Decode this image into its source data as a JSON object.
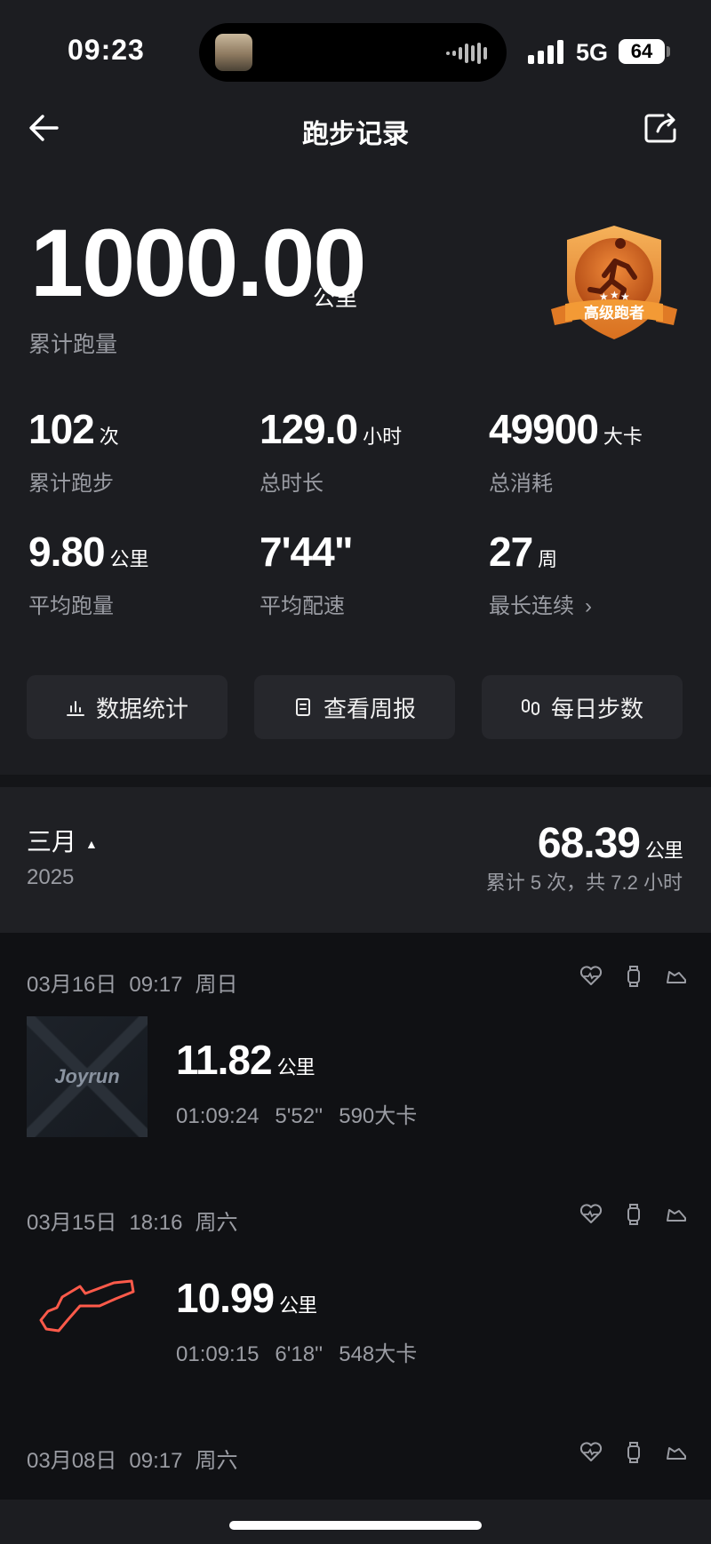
{
  "status": {
    "time": "09:23",
    "network": "5G",
    "battery": "64"
  },
  "nav": {
    "title": "跑步记录"
  },
  "summary": {
    "total_value": "1000.00",
    "total_unit": "公里",
    "total_label": "累计跑量",
    "badge_text": "高级跑者"
  },
  "stats": [
    {
      "value": "102",
      "unit": "次",
      "label": "累计跑步"
    },
    {
      "value": "129.0",
      "unit": "小时",
      "label": "总时长"
    },
    {
      "value": "49900",
      "unit": "大卡",
      "label": "总消耗"
    },
    {
      "value": "9.80",
      "unit": "公里",
      "label": "平均跑量"
    },
    {
      "value": "7'44\"",
      "unit": "",
      "label": "平均配速"
    },
    {
      "value": "27",
      "unit": "周",
      "label": "最长连续"
    }
  ],
  "actions": [
    {
      "label": "数据统计",
      "icon": "bar-chart-icon"
    },
    {
      "label": "查看周报",
      "icon": "report-icon"
    },
    {
      "label": "每日步数",
      "icon": "footprint-icon"
    }
  ],
  "month": {
    "name": "三月",
    "year": "2025",
    "km": "68.39",
    "km_unit": "公里",
    "summary": "累计 5 次，共 7.2 小时"
  },
  "records": [
    {
      "date": "03月16日",
      "time": "09:17",
      "weekday": "周日",
      "thumb_text": "Joyrun",
      "km": "11.82",
      "km_unit": "公里",
      "duration": "01:09:24",
      "pace": "5'52''",
      "kcal": "590大卡"
    },
    {
      "date": "03月15日",
      "time": "18:16",
      "weekday": "周六",
      "km": "10.99",
      "km_unit": "公里",
      "duration": "01:09:15",
      "pace": "6'18''",
      "kcal": "548大卡"
    },
    {
      "date": "03月08日",
      "time": "09:17",
      "weekday": "周六"
    }
  ],
  "colors": {
    "background": "#1c1d21",
    "card": "#26272c",
    "muted": "#9a9ca3",
    "route": "#ff5a4a",
    "badge": "#e8862a"
  }
}
